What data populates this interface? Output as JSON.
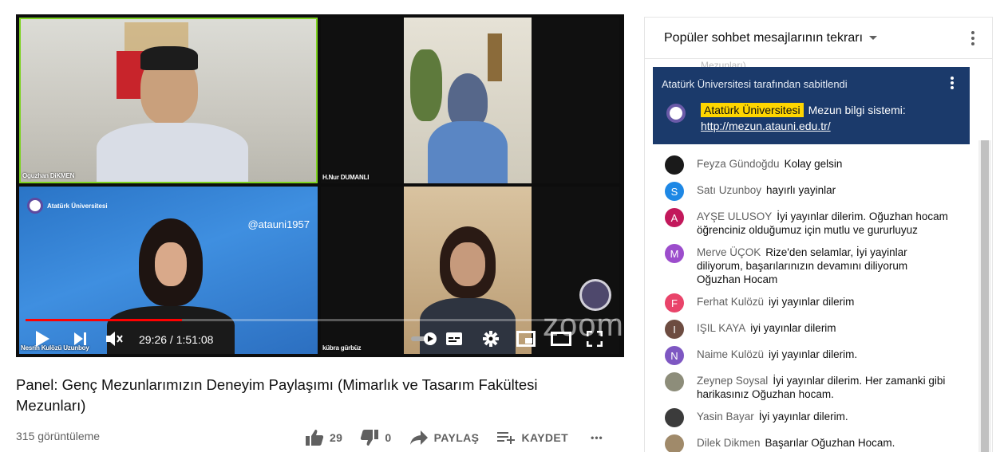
{
  "player": {
    "participants": {
      "tile1": "Oguzhan DiKMEN",
      "tile2": "H.Nur DUMANLI",
      "tile3": "Nesrin Kulözü Uzunboy",
      "tile4": "kübra gürbüz"
    },
    "handle": "@atauni1957",
    "brand_text": "Atatürk Üniversitesi",
    "watermark": "zoom",
    "time_current": "29:26",
    "time_separator": " / ",
    "time_total": "1:51:08",
    "progress": 0.265
  },
  "video": {
    "title": "Panel: Genç Mezunlarımızın Deneyim Paylaşımı (Mimarlık ve Tasarım Fakültesi Mezunları)",
    "views": "315 görüntüleme",
    "likes": "29",
    "dislikes": "0",
    "share_label": "PAYLAŞ",
    "save_label": "KAYDET",
    "more_label": "•••"
  },
  "chat": {
    "title": "Popüler sohbet mesajlarının tekrarı",
    "ghost_text": "Mezunları)",
    "pinned": {
      "header": "Atatürk Üniversitesi tarafından sabitlendi",
      "author": "Atatürk Üniversitesi",
      "text": "Mezun bilgi sistemi: ",
      "link": "http://mezun.atauni.edu.tr/"
    },
    "messages": [
      {
        "author": "Feyza Gündoğdu",
        "text": "Kolay gelsin",
        "initial": "",
        "color": "#1a1a1a"
      },
      {
        "author": "Satı Uzunboy",
        "text": "hayırlı yayinlar",
        "initial": "S",
        "color": "#1e88e5"
      },
      {
        "author": "AYŞE ULUSOY",
        "text": "İyi yayınlar dilerim. Oğuzhan hocam öğrenciniz olduğumuz için mutlu ve gururluyuz",
        "initial": "A",
        "color": "#c2185b"
      },
      {
        "author": "Merve ÜÇOK",
        "text": "Rize'den selamlar, İyi yayinlar diliyorum, başarılarınızın devamını diliyorum Oğuzhan Hocam",
        "initial": "M",
        "color": "#9c4dcc"
      },
      {
        "author": "Ferhat Kulözü",
        "text": "iyi yayınlar dilerim",
        "initial": "F",
        "color": "#e9446a"
      },
      {
        "author": "IŞIL KAYA",
        "text": "iyi yayınlar dilerim",
        "initial": "I",
        "color": "#6d4c41"
      },
      {
        "author": "Naime Kulözü",
        "text": "iyi yayınlar dilerim.",
        "initial": "N",
        "color": "#7e57c2"
      },
      {
        "author": "Zeynep Soysal",
        "text": "İyi yayınlar dilerim. Her zamanki gibi harikasınız Oğuzhan hocam.",
        "initial": "",
        "color": "#8d8d7a"
      },
      {
        "author": "Yasin Bayar",
        "text": "İyi yayınlar dilerim.",
        "initial": "",
        "color": "#3b3b3b"
      },
      {
        "author": "Dilek Dikmen",
        "text": "Başarılar Oğuzhan Hocam.",
        "initial": "",
        "color": "#a08a6a"
      }
    ]
  },
  "colors": {
    "accent_red": "#ff0000",
    "pinned_bg": "#1b3a6b",
    "badge_yellow": "#ffd600",
    "speaker_border": "#7ed321"
  }
}
